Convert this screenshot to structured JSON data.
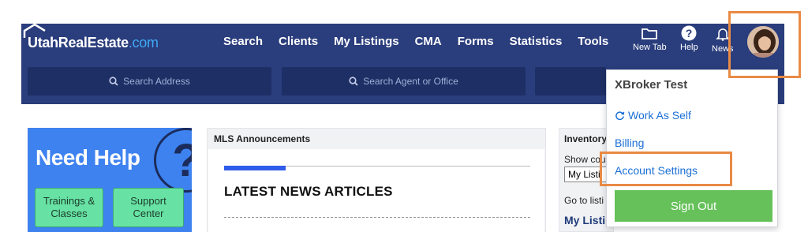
{
  "header": {
    "logo_text": "UtahRealEstate",
    "logo_suffix": ".com",
    "nav": [
      "Search",
      "Clients",
      "My Listings",
      "CMA",
      "Forms",
      "Statistics",
      "Tools"
    ],
    "icons": {
      "new_tab": {
        "label": "New Tab",
        "icon": "folder-icon"
      },
      "help": {
        "label": "Help",
        "icon": "question-circle-icon"
      },
      "news": {
        "label": "News",
        "icon": "bell-icon"
      }
    },
    "search_address_placeholder": "Search Address",
    "search_agent_placeholder": "Search Agent or Office"
  },
  "user_menu": {
    "name": "XBroker Test",
    "items": {
      "work_as_self": "Work As Self",
      "billing": "Billing",
      "account_settings": "Account Settings"
    },
    "sign_out": "Sign Out"
  },
  "help_card": {
    "title": "Need Help",
    "buttons": {
      "trainings": "Trainings & Classes",
      "support": "Support Center"
    }
  },
  "announcements": {
    "header": "MLS Announcements",
    "heading": "LATEST NEWS ARTICLES"
  },
  "inventory": {
    "header": "Inventory",
    "show_label": "Show cou",
    "select_value": "My Listi",
    "goto_label": "Go to listi",
    "my_listings": "My Listi"
  },
  "colors": {
    "header_bg": "#2a3d7c",
    "accent_orange": "#e98a45",
    "sign_out_green": "#66c15a",
    "link_blue": "#1a6fd6",
    "help_blue": "#3e82f0"
  }
}
